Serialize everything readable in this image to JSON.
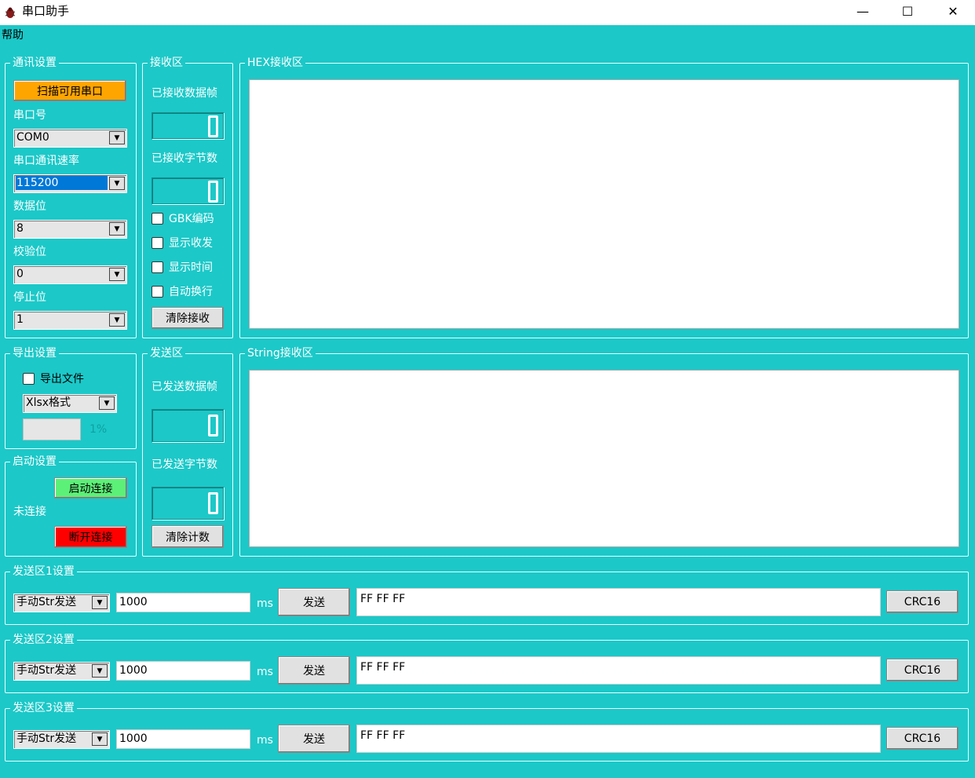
{
  "window": {
    "title": "串口助手",
    "minimize": "—",
    "maximize": "☐",
    "close": "✕"
  },
  "menu": {
    "help": "帮助"
  },
  "comm": {
    "legend": "通讯设置",
    "scan_button": "扫描可用串口",
    "port_label": "串口号",
    "port_value": "COM0",
    "baud_label": "串口通讯速率",
    "baud_value": "115200",
    "databits_label": "数据位",
    "databits_value": "8",
    "parity_label": "校验位",
    "parity_value": "0",
    "stopbits_label": "停止位",
    "stopbits_value": "1"
  },
  "receive": {
    "legend": "接收区",
    "frames_label": "已接收数据帧",
    "bytes_label": "已接收字节数",
    "frames_value": 0,
    "bytes_value": 0,
    "gbk": "GBK编码",
    "show_txrx": "显示收发",
    "show_time": "显示时间",
    "auto_wrap": "自动换行",
    "clear_button": "清除接收"
  },
  "hex_area": {
    "legend": "HEX接收区"
  },
  "export": {
    "legend": "导出设置",
    "export_file": "导出文件",
    "format_value": "Xlsx格式",
    "progress_text": "1%",
    "progress": 0.01
  },
  "startup": {
    "legend": "启动设置",
    "connect_button": "启动连接",
    "status": "未连接",
    "disconnect_button": "断开连接"
  },
  "send": {
    "legend": "发送区",
    "frames_label": "已发送数据帧",
    "bytes_label": "已发送字节数",
    "frames_value": 0,
    "bytes_value": 0,
    "clear_button": "清除计数"
  },
  "string_area": {
    "legend": "String接收区"
  },
  "send_rows": [
    {
      "legend": "发送区1设置",
      "mode": "手动Str发送",
      "interval": "1000",
      "unit": "ms",
      "send_button": "发送",
      "payload": "FF FF FF",
      "crc_button": "CRC16"
    },
    {
      "legend": "发送区2设置",
      "mode": "手动Str发送",
      "interval": "1000",
      "unit": "ms",
      "send_button": "发送",
      "payload": "FF FF FF",
      "crc_button": "CRC16"
    },
    {
      "legend": "发送区3设置",
      "mode": "手动Str发送",
      "interval": "1000",
      "unit": "ms",
      "send_button": "发送",
      "payload": "FF FF FF",
      "crc_button": "CRC16"
    }
  ],
  "colors": {
    "background": "#1CC8C8",
    "scan_button": "#FFA500",
    "connect_button": "#5CF078",
    "disconnect_button": "#FF0000",
    "selection": "#0078D7"
  }
}
